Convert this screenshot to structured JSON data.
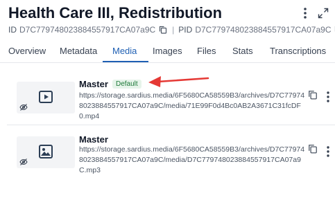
{
  "asset": {
    "title": "Health Care III, Redistribution",
    "id_label": "ID",
    "id_value": "D7C779748023884557917CA07a9C",
    "pid_label": "PID",
    "pid_value": "D7C779748023884557917CA07a9C",
    "divider": "|"
  },
  "header_icons": [
    "kebab-menu-icon",
    "expand-icon"
  ],
  "tabs": [
    {
      "label": "Overview"
    },
    {
      "label": "Metadata"
    },
    {
      "label": "Media"
    },
    {
      "label": "Images"
    },
    {
      "label": "Files"
    },
    {
      "label": "Stats"
    },
    {
      "label": "Transcriptions"
    }
  ],
  "active_tab": "Media",
  "media": [
    {
      "title": "Master",
      "badge": "Default",
      "url": "https://storage.sardius.media/6F5680CA58559B3/archives/D7C779748023884557917CA07a9C/media/71E99F0d4Bc0AB2A3671C31fcDF0.mp4",
      "thumb_icon": "video-play-icon"
    },
    {
      "title": "Master",
      "badge": "",
      "url": "https://storage.sardius.media/6F5680CA58559B3/archives/D7C779748023884557917CA07a9C/media/D7C779748023884557917CA07a9C.mp3",
      "thumb_icon": "image-icon"
    }
  ],
  "colors": {
    "accent": "#1e5fb3",
    "badge_text": "#1f7a3a",
    "badge_bg": "#e6f4ea",
    "annotation_arrow": "#e53935"
  }
}
